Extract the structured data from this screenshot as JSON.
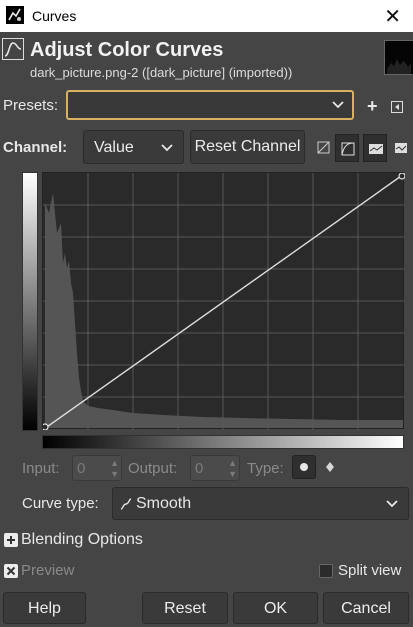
{
  "window": {
    "title": "Curves"
  },
  "header": {
    "title": "Adjust Color Curves",
    "subtitle": "dark_picture.png-2 ([dark_picture] (imported))"
  },
  "presets": {
    "label": "Presets:",
    "value": ""
  },
  "channel": {
    "label": "Channel:",
    "value": "Value",
    "reset_label": "Reset Channel"
  },
  "point": {
    "input_label": "Input:",
    "input_value": "0",
    "output_label": "Output:",
    "output_value": "0",
    "type_label": "Type:"
  },
  "curve_type": {
    "label": "Curve type:",
    "value": "Smooth"
  },
  "blending": {
    "label": "Blending Options"
  },
  "preview": {
    "label": "Preview"
  },
  "split_view": {
    "label": "Split view"
  },
  "buttons": {
    "help": "Help",
    "reset": "Reset",
    "ok": "OK",
    "cancel": "Cancel"
  },
  "colors": {
    "accent_border": "#d7b062",
    "background": "#454545"
  },
  "histogram": {
    "channel": "Value",
    "x_range": [
      0,
      255
    ]
  },
  "curve": {
    "points": [
      [
        0,
        0
      ],
      [
        255,
        255
      ]
    ]
  }
}
